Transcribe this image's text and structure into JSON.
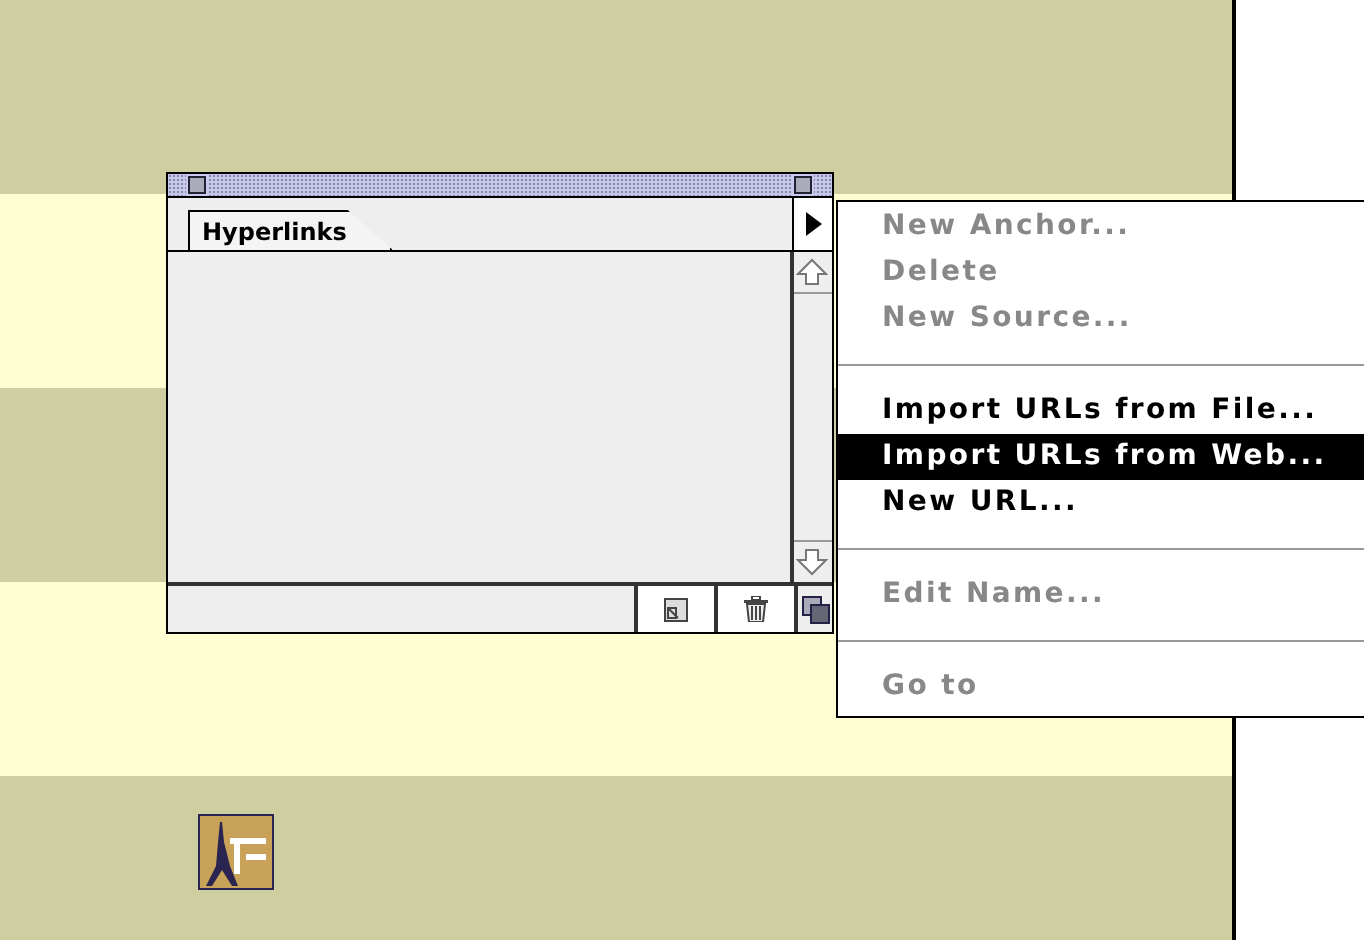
{
  "panel": {
    "tabs": [
      {
        "label": "Hyperlinks",
        "selected": true
      }
    ]
  },
  "menu": {
    "items": [
      {
        "kind": "item",
        "label": "New Anchor...",
        "disabled": true,
        "selected": false
      },
      {
        "kind": "item",
        "label": "Delete",
        "disabled": true,
        "selected": false
      },
      {
        "kind": "item",
        "label": "New Source...",
        "disabled": true,
        "selected": false
      },
      {
        "kind": "separator"
      },
      {
        "kind": "item",
        "label": "Import URLs from File...",
        "disabled": false,
        "selected": false
      },
      {
        "kind": "item",
        "label": "Import URLs from Web...",
        "disabled": false,
        "selected": true
      },
      {
        "kind": "item",
        "label": "New URL...",
        "disabled": false,
        "selected": false
      },
      {
        "kind": "separator"
      },
      {
        "kind": "item",
        "label": "Edit Name...",
        "disabled": true,
        "selected": false
      },
      {
        "kind": "separator"
      },
      {
        "kind": "item",
        "label": "Go to",
        "disabled": true,
        "selected": false
      }
    ]
  }
}
